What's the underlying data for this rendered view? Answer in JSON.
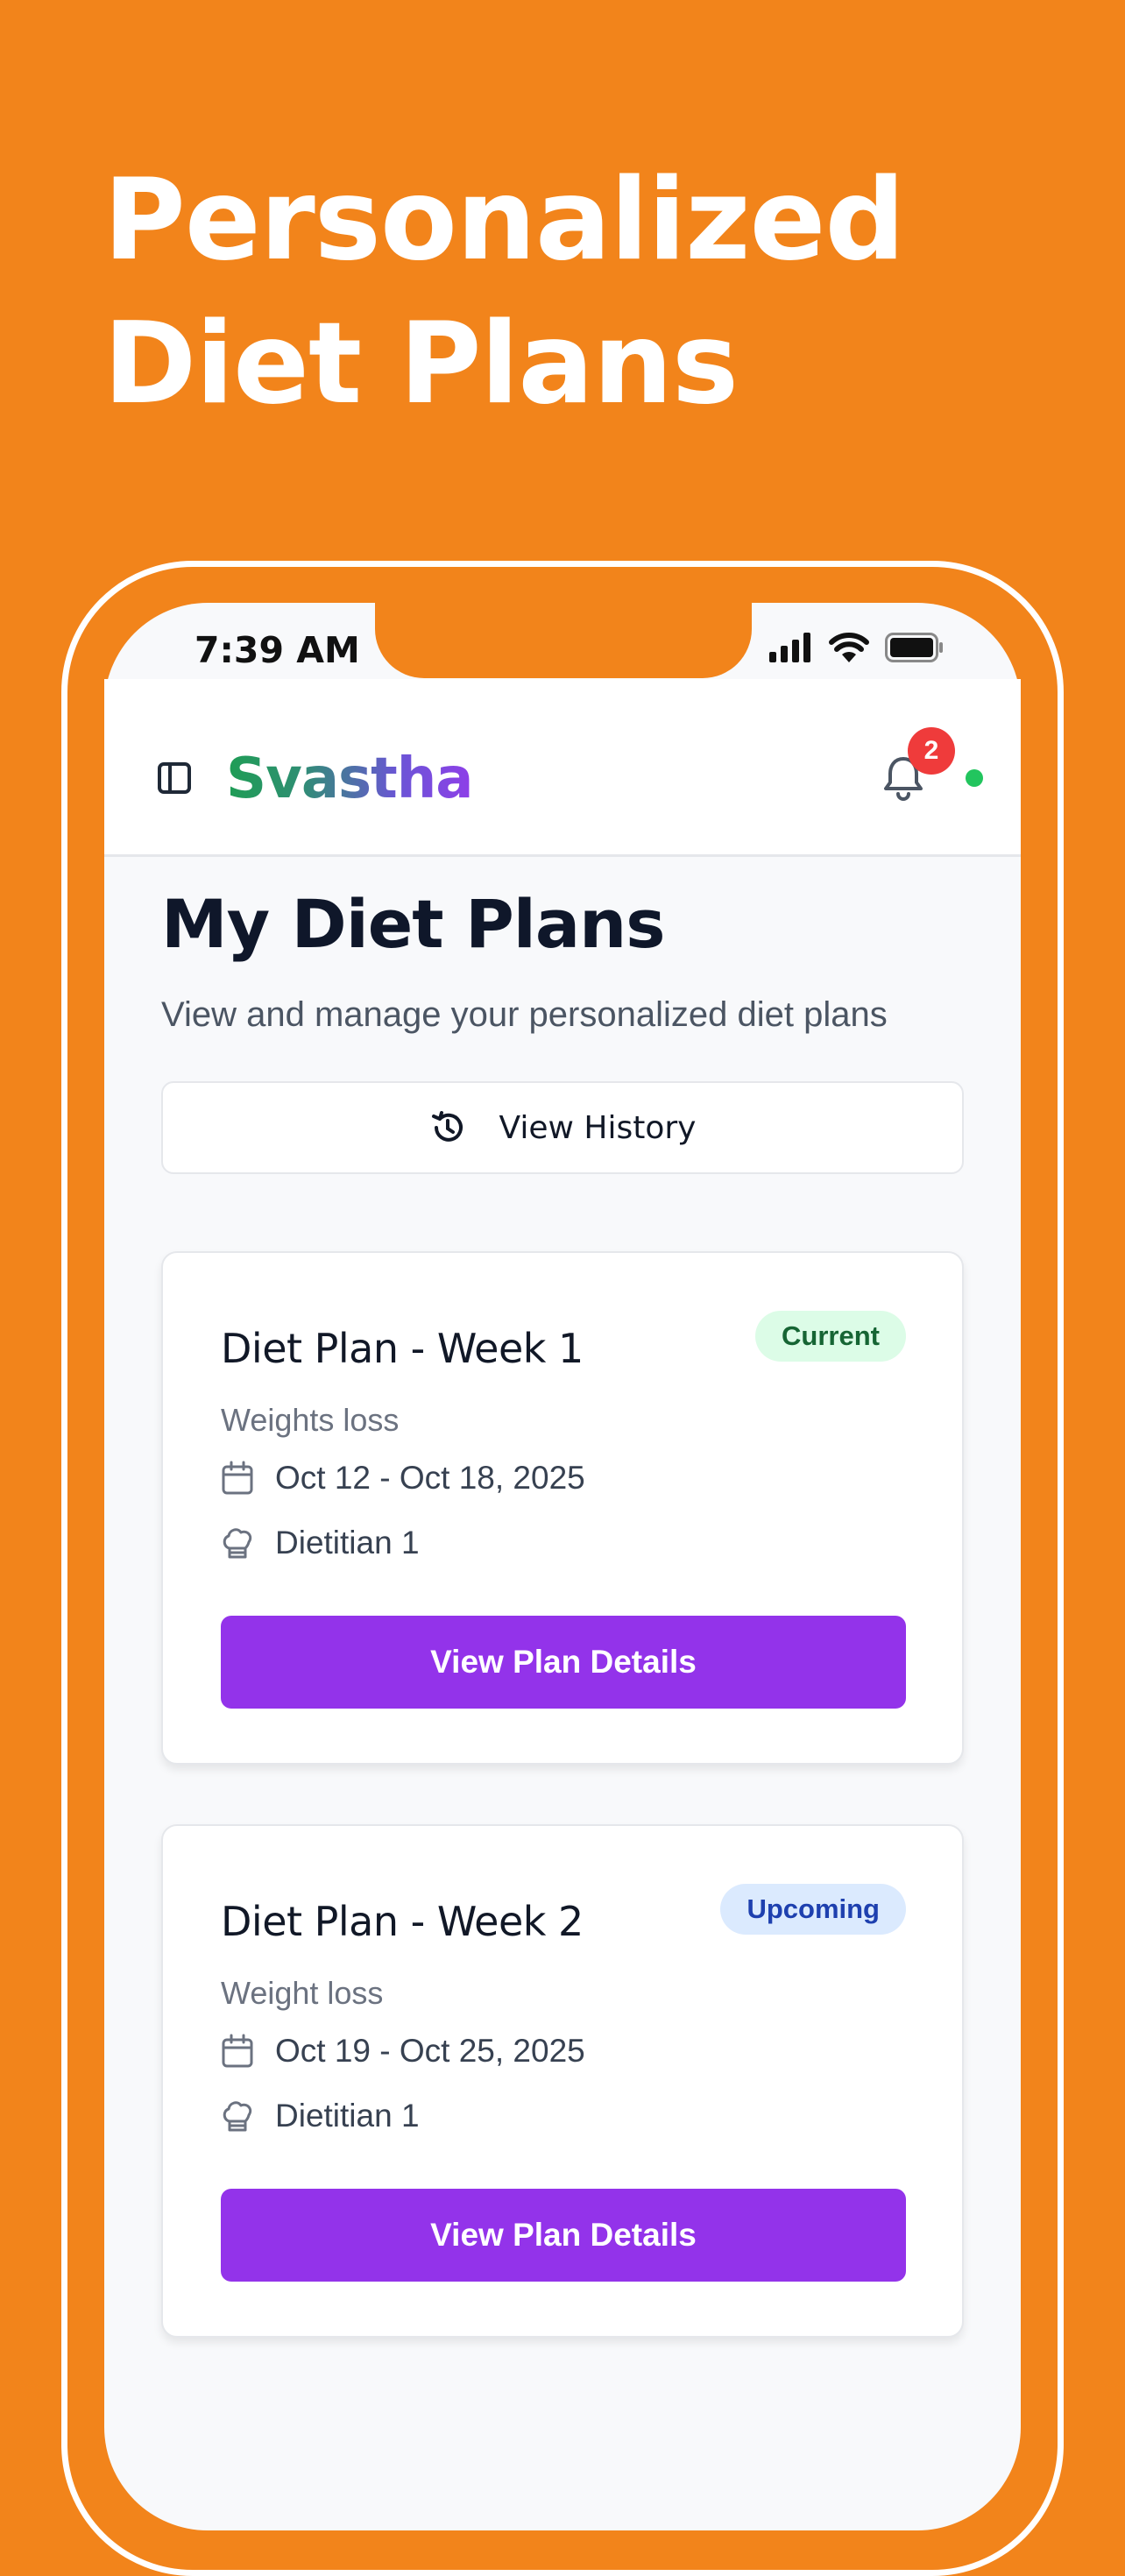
{
  "headline": {
    "line1": "Personalized",
    "line2": "Diet Plans"
  },
  "status_bar": {
    "time": "7:39 AM",
    "icons": [
      "signal-icon",
      "wifi-icon",
      "battery-icon"
    ]
  },
  "app_header": {
    "brand": "Svastha",
    "notification_count": "2",
    "online": true
  },
  "page": {
    "title": "My Diet Plans",
    "subtitle": "View and manage your personalized diet plans",
    "history_button": "View History"
  },
  "plans": [
    {
      "title": "Diet Plan - Week 1",
      "status": "Current",
      "goal": "Weights loss",
      "dates": "Oct 12 - Oct 18, 2025",
      "dietitian": "Dietitian 1",
      "button": "View Plan Details"
    },
    {
      "title": "Diet Plan - Week 2",
      "status": "Upcoming",
      "goal": "Weight loss",
      "dates": "Oct 19 - Oct 25, 2025",
      "dietitian": "Dietitian 1",
      "button": "View Plan Details"
    }
  ],
  "colors": {
    "background": "#F2841B",
    "primary_button": "#9333EA",
    "current_badge_bg": "#DCFCE7",
    "upcoming_badge_bg": "#DBEAFE",
    "notification_badge": "#EF3B3B",
    "online_dot": "#22C55E"
  }
}
